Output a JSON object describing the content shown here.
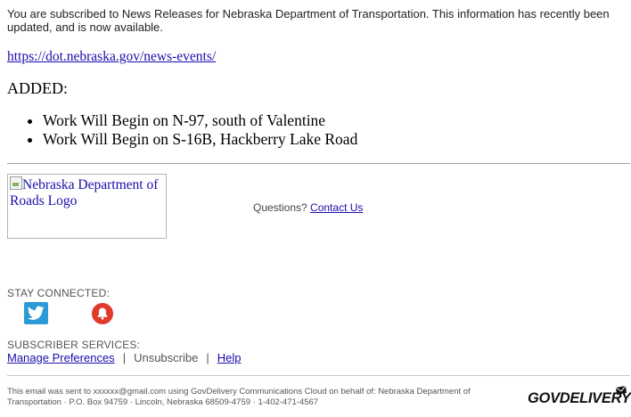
{
  "intro": "You are subscribed to News Releases for Nebraska Department of Transportation. This information has recently been updated, and is now available.",
  "link_url": "https://dot.nebraska.gov/news-events/",
  "added_heading": "ADDED:",
  "news_items": [
    "Work Will Begin on N-97, south of Valentine",
    "Work Will Begin on S-16B, Hackberry Lake Road"
  ],
  "logo_alt": "Nebraska Department of Roads Logo",
  "questions": {
    "prefix": "Questions?",
    "contact_label": "Contact Us"
  },
  "stay_connected": "STAY CONNECTED:",
  "social": [
    {
      "icon": "twitter-icon",
      "color": "#2b9ad7"
    },
    {
      "icon": "alert-bell-icon",
      "color": "#e03a2b"
    }
  ],
  "subscriber_services": "SUBSCRIBER SERVICES:",
  "subscriber_links": {
    "manage": "Manage Preferences",
    "sep1": "|",
    "unsubscribe": "Unsubscribe",
    "sep2": "|",
    "help": "Help"
  },
  "footer": "This email was sent to xxxxxx@gmail.com using GovDelivery Communications Cloud on behalf of: Nebraska Department of Transportation · P.O. Box 94759 · Lincoln, Nebraska 68509-4759 · 1-402-471-4567",
  "brand": "GOVDELIVERY",
  "colors": {
    "link": "#1a0dab"
  }
}
